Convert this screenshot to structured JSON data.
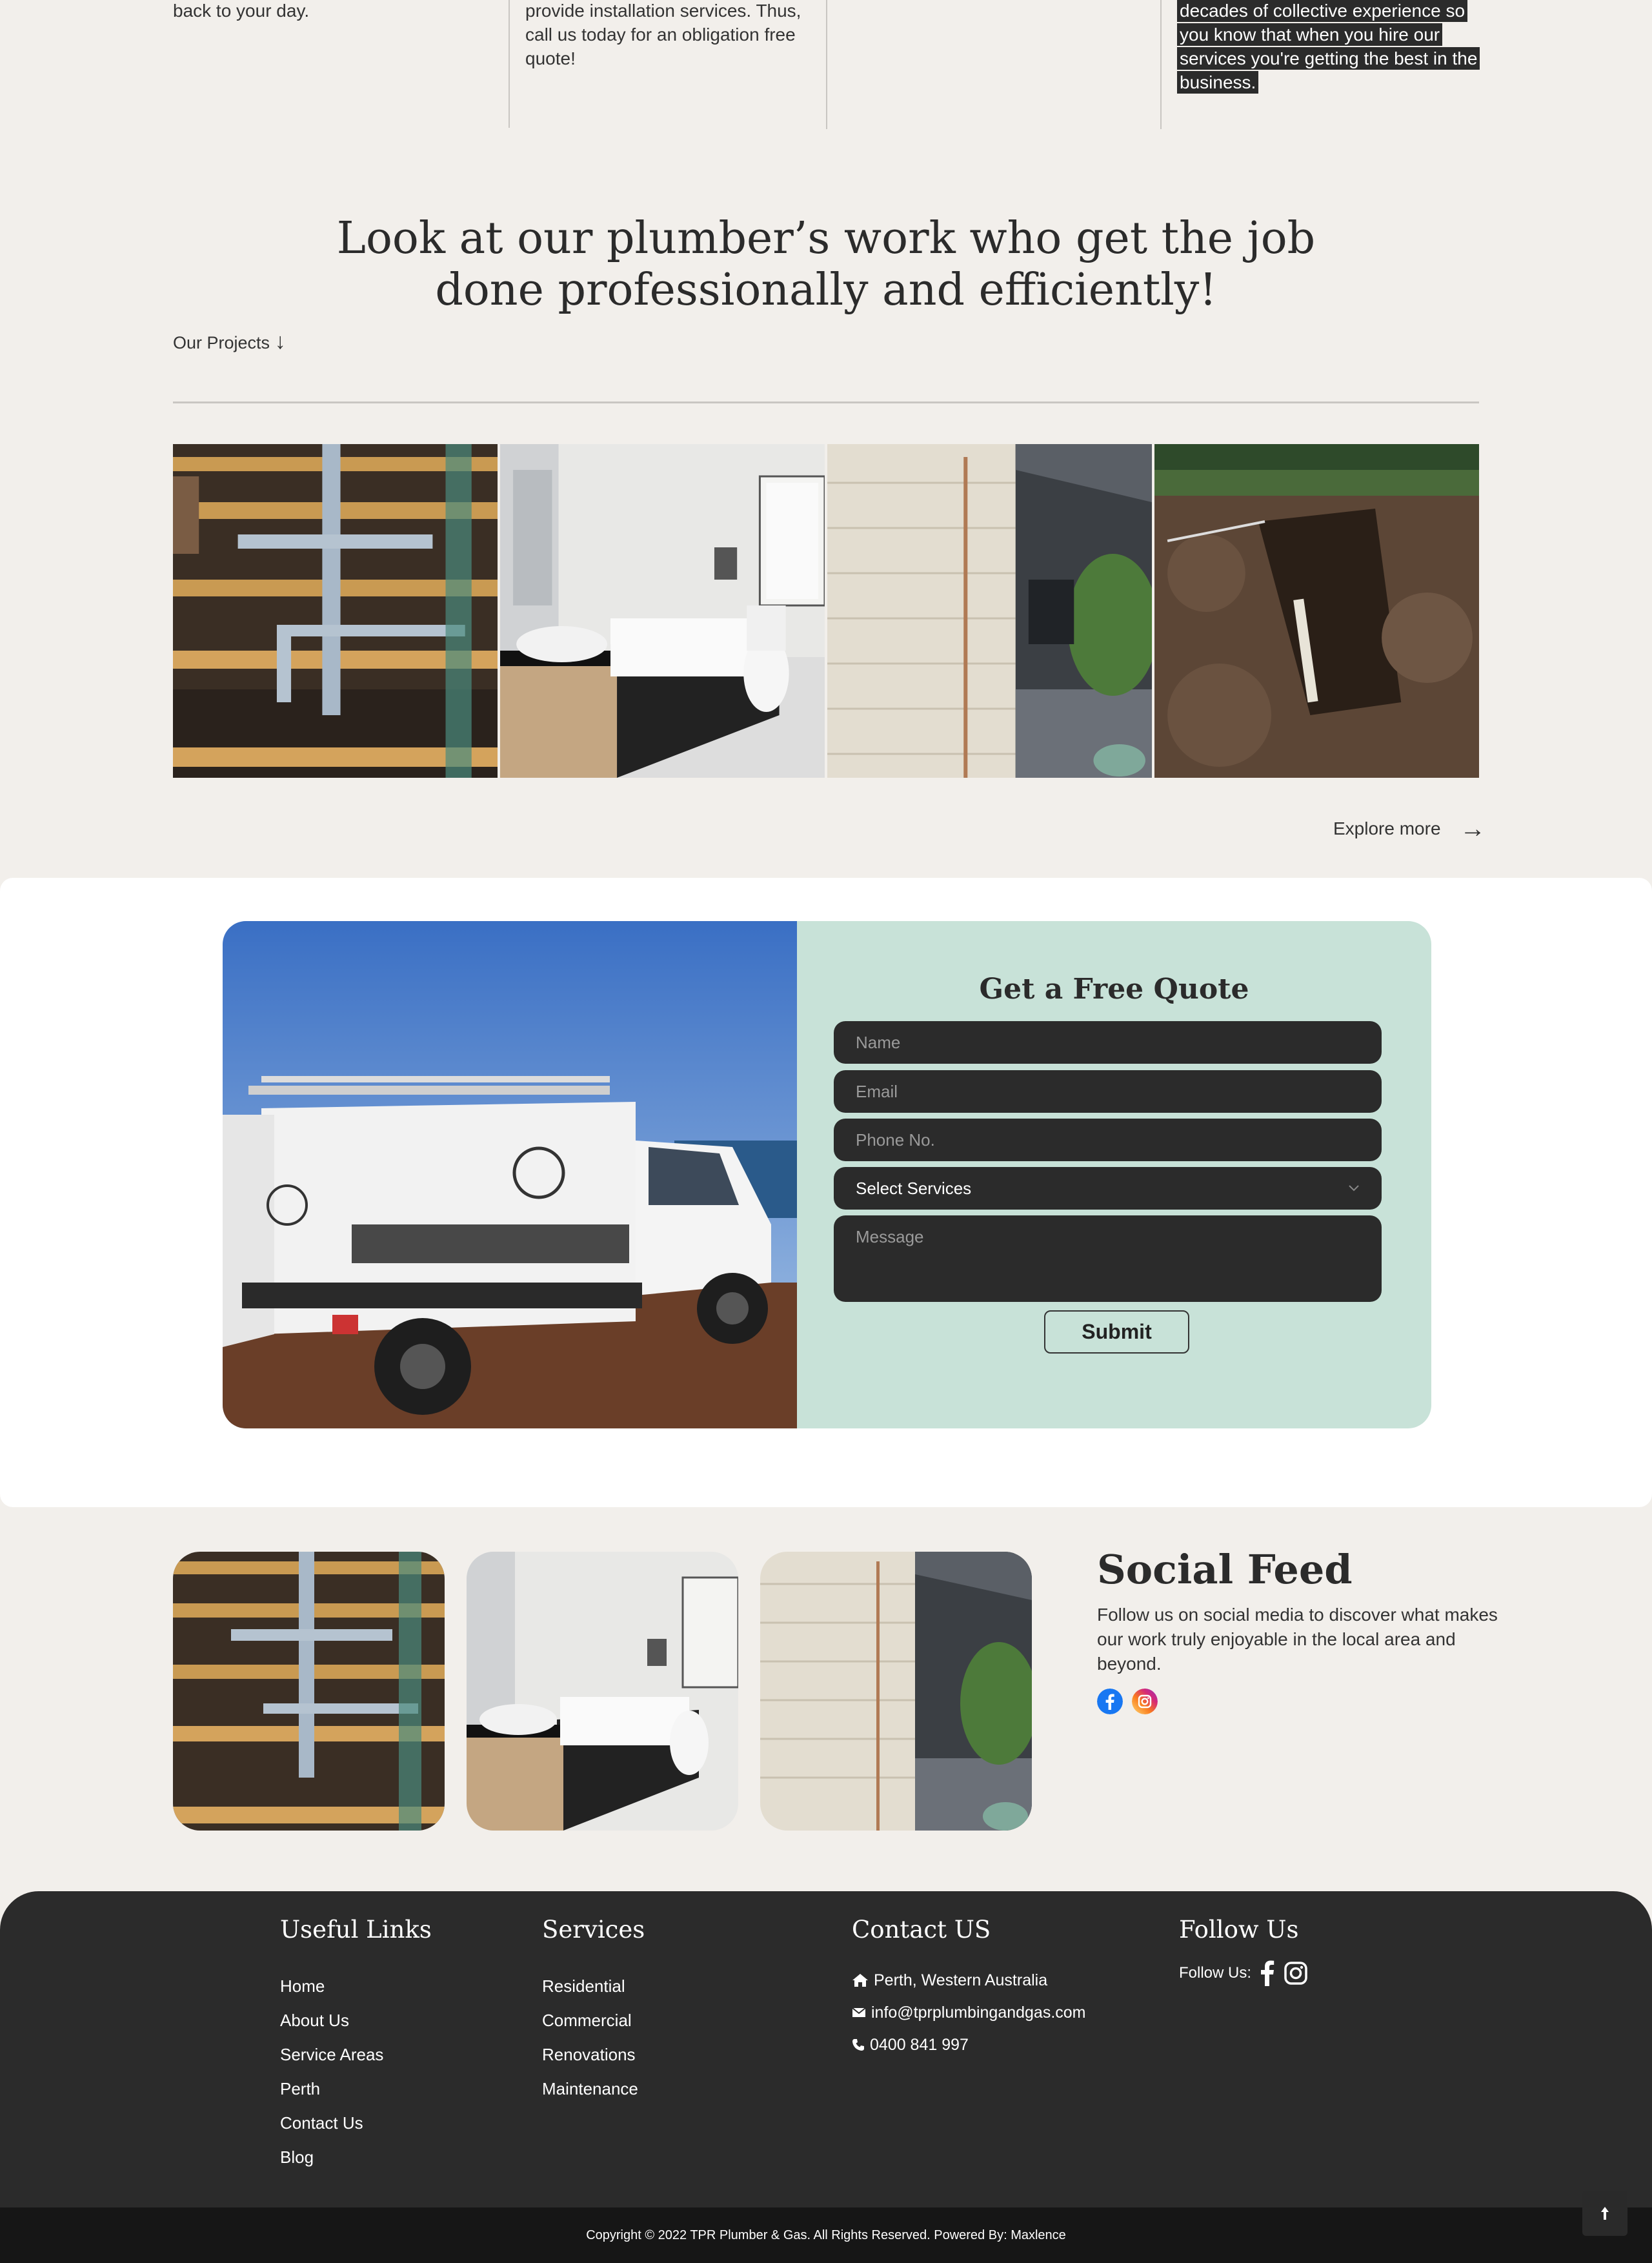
{
  "features": {
    "col1_text": "back to your day.",
    "col2_text": "provide installation services. Thus, call us today for an obligation free quote!",
    "col4_text": "decades of collective experience so you know that when you hire our services you're getting the best in the business."
  },
  "projects": {
    "title": "Look at our plumber’s work who get the job done professionally and efficiently!",
    "label": "Our Projects",
    "label_arrow": "↓",
    "explore": "Explore more",
    "explore_arrow": "→"
  },
  "quote": {
    "title": "Get a Free Quote",
    "name_placeholder": "Name",
    "email_placeholder": "Email",
    "phone_placeholder": "Phone No.",
    "services_selected": "Select Services",
    "message_placeholder": "Message",
    "submit": "Submit"
  },
  "social": {
    "title": "Social Feed",
    "text": "Follow us on social media to discover what makes our work truly enjoyable in the local area and beyond."
  },
  "footer": {
    "useful_links_title": "Useful Links",
    "useful_links": [
      "Home",
      "About Us",
      "Service Areas",
      "Perth",
      "Contact Us",
      "Blog"
    ],
    "services_title": "Services",
    "services": [
      "Residential",
      "Commercial",
      "Renovations",
      "Maintenance"
    ],
    "contact_title": "Contact US",
    "address": "Perth, Western Australia",
    "email": "info@tprplumbingandgas.com",
    "phone": "0400 841 997",
    "follow_title": "Follow Us",
    "follow_label": "Follow Us:"
  },
  "copyright": "Copyright © 2022 TPR Plumber & Gas. All Rights Reserved. Powered By: Maxlence",
  "colors": {
    "page_bg": "#f2efeb",
    "dark": "#2b2b2b",
    "quote_bg": "#c8e2d8"
  }
}
